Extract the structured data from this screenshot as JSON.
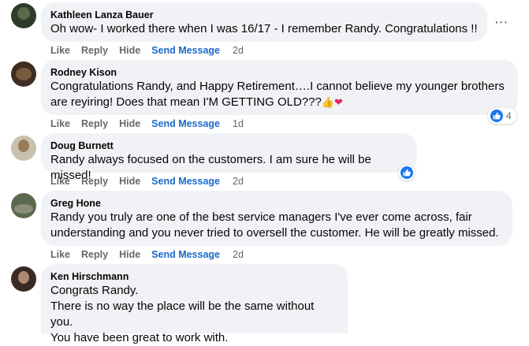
{
  "actions": {
    "like": "Like",
    "reply": "Reply",
    "hide": "Hide",
    "send_message": "Send Message"
  },
  "more_icon": "···",
  "comments": [
    {
      "author": "Kathleen Lanza Bauer",
      "text": "Oh wow- I worked there when I was 16/17 - I remember Randy. Congratulations !!",
      "time": "2d"
    },
    {
      "author": "Rodney Kison",
      "text_line1": "Congratulations Randy, and Happy Retirement….I cannot believe my younger brothers",
      "text_line2": "are reyiring! Does that mean I'M GETTING OLD???",
      "emoji_thumb": "👍",
      "emoji_heart": "❤",
      "reaction_count": "4",
      "time": "1d"
    },
    {
      "author": "Doug Burnett",
      "text": "Randy always focused on the customers. I am sure he will be missed!",
      "time": "2d"
    },
    {
      "author": "Greg Hone",
      "text_line1": "Randy you truly are one of the best service managers I've ever come across, fair",
      "text_line2": "understanding and you never tried to oversell the customer. He will be greatly missed.",
      "time": "2d"
    },
    {
      "author": "Ken Hirschmann",
      "text_line1": "Congrats Randy.",
      "text_line2": "There is no way the place will be the same without you.",
      "text_line3": "You have been great to work with."
    }
  ],
  "colors": {
    "bubble": "#f0f2f5",
    "link": "#1b6ac9",
    "like_blue": "#1877f2",
    "muted": "#65676b"
  }
}
